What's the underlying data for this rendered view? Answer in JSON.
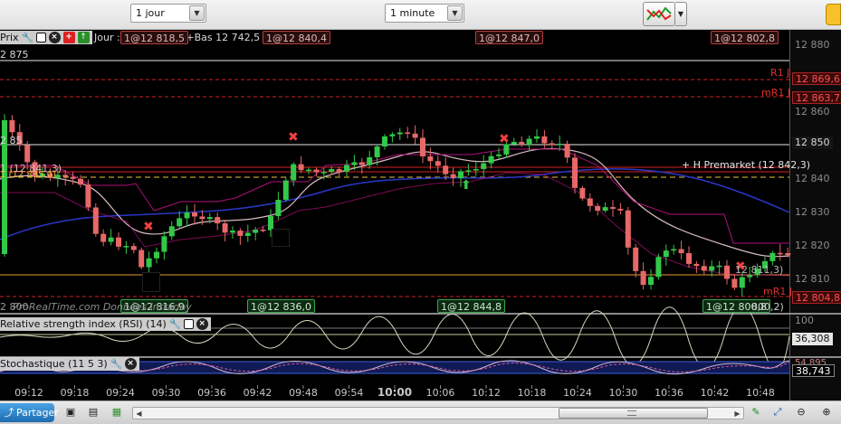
{
  "toolbar": {
    "period": "1 jour",
    "interval": "1 minute"
  },
  "price_panel": {
    "legend_label": "Prix",
    "info_text": "Jour :+@12 839,5 +Bas 12 742,5",
    "top_left_value": "2 875",
    "partial_value": "2 85",
    "partial_label_mid": "1 (12 841,3)",
    "partial_label_mid2": "1 (12 835,0)",
    "watermark": "ProRealTime.com  Données intraday",
    "watermark_left": "2 800",
    "top_tags": [
      "1@12 818,5",
      "1@12 840,4",
      "1@12 847,0",
      "1@12 802,8"
    ],
    "bottom_tags": [
      "1@12 816,9",
      "1@12 836,0",
      "1@12 844,8",
      "1@12 800,8"
    ],
    "premarket_label": "+ H Premarket (12 842,3)",
    "right_mid_label": "12 811,3)",
    "right_bottom_label": "800,2)",
    "levels": [
      {
        "label": "R1 J",
        "value": "12 869,6"
      },
      {
        "label": "mR1 J",
        "value": "12 863,7"
      },
      {
        "label": "mR1 J",
        "value": "12 804,8"
      }
    ],
    "y_ticks": [
      "12 880",
      "12 870",
      "12 860",
      "12 850",
      "12 840",
      "12 830",
      "12 820",
      "12 810"
    ]
  },
  "rsi_panel": {
    "legend_label": "Relative strength index (RSI) (14)",
    "top_tick": "100",
    "value": "36,308"
  },
  "stoch_panel": {
    "legend_label": "Stochastique (11 5 3)",
    "value_upper": "54,895",
    "value": "38,743"
  },
  "time_axis": {
    "labels": [
      "09:12",
      "09:18",
      "09:24",
      "09:30",
      "09:36",
      "09:42",
      "09:48",
      "09:54",
      "10:00",
      "10:06",
      "10:12",
      "10:18",
      "10:24",
      "10:30",
      "10:36",
      "10:42",
      "10:48"
    ]
  },
  "bottom_bar": {
    "share_label": "Partager"
  },
  "colors": {
    "bull": "#33c84a",
    "bear": "#e86868",
    "ma_fast": "#d8b8c0",
    "ma_slow": "#2a37c8",
    "envelope": "#b0107a",
    "level_red": "#d42222",
    "premarket": "#e8c23a",
    "support": "#e89a30"
  }
}
